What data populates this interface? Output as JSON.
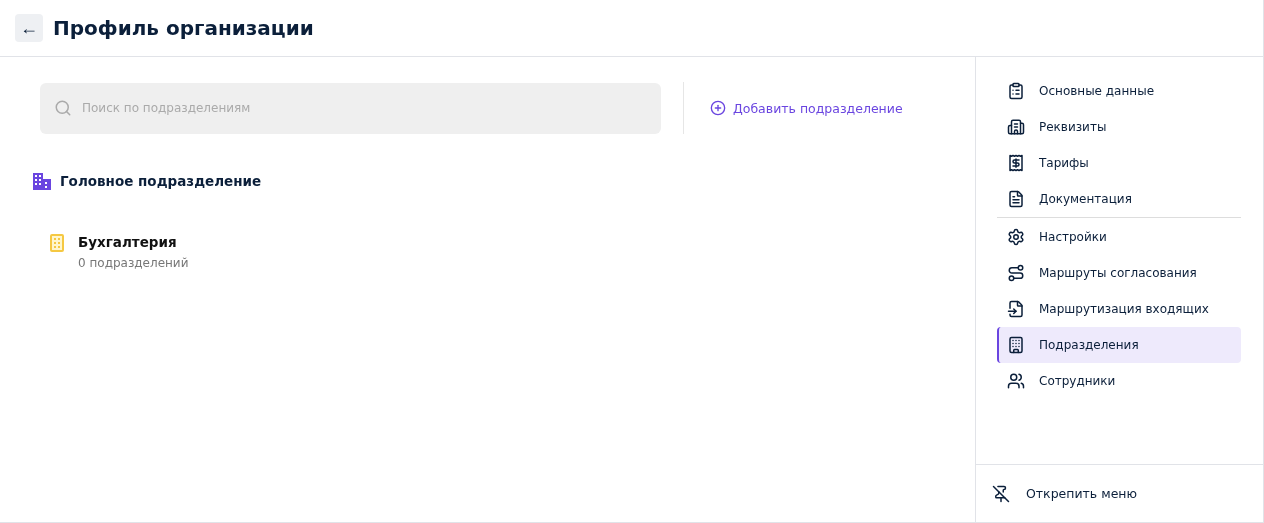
{
  "header": {
    "back": "←",
    "title": "Профиль организации"
  },
  "search": {
    "placeholder": "Поиск по подразделениям"
  },
  "add_button": {
    "label": "Добавить подразделение"
  },
  "head_unit": {
    "name": "Головное подразделение"
  },
  "units": [
    {
      "name": "Бухгалтерия",
      "count": "0 подразделений"
    }
  ],
  "menu": {
    "groups": [
      {
        "items": [
          {
            "label": "Основные данные",
            "selected": false
          },
          {
            "label": "Реквизиты",
            "selected": false
          },
          {
            "label": "Тарифы",
            "selected": false
          },
          {
            "label": "Документация",
            "selected": false
          }
        ]
      },
      {
        "items": [
          {
            "label": "Настройки",
            "selected": false
          },
          {
            "label": "Маршруты согласования",
            "selected": false
          },
          {
            "label": "Маршрутизация входящих",
            "selected": false
          },
          {
            "label": "Подразделения",
            "selected": true
          },
          {
            "label": "Сотрудники",
            "selected": false
          }
        ]
      }
    ],
    "footer": {
      "label": "Открепить меню"
    }
  }
}
